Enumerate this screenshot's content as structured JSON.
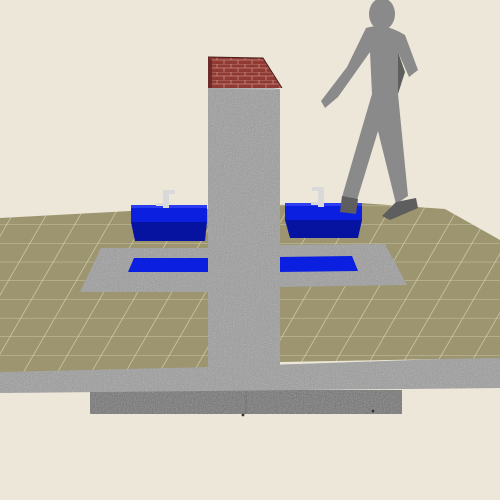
{
  "scene": {
    "kind": "3d-model-render",
    "subject": "double-sided-wash-basin-station",
    "colors": {
      "background": "#ece7d8",
      "floor_tile": "#9c9570",
      "tile_grout": "#d2cdae",
      "granite": "#9c9c9c",
      "granite_light": "#b4b4b4",
      "granite_dark": "#6e6e6e",
      "brick_cap": "#8f3a33",
      "basin_blue": "#0a1fe0",
      "basin_blue_dark": "#0612a0",
      "faucet": "#d9d9d9",
      "person": "#8a8a8a",
      "person_shadow": "#5e5e5e"
    },
    "objects": [
      "floor-slab",
      "tiled-floor",
      "drain-trough",
      "water-channel",
      "center-pillar",
      "brick-cap",
      "left-sink",
      "right-sink",
      "left-faucet",
      "right-faucet",
      "walking-person",
      "base-footing"
    ]
  }
}
